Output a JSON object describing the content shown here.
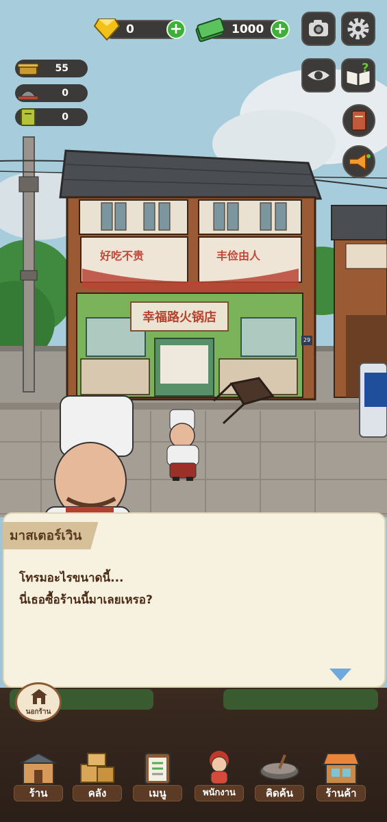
{
  "currency": {
    "gems": "0",
    "cash": "1000"
  },
  "stats": [
    {
      "icon": "hotpot-icon",
      "value": "55"
    },
    {
      "icon": "dish-cloche-icon",
      "value": "0"
    },
    {
      "icon": "recipe-book-icon",
      "value": "0"
    }
  ],
  "shop": {
    "signboard": "幸福路火锅店",
    "left_slogan": "好吃不贵",
    "right_slogan": "丰俭由人",
    "door_number": "29"
  },
  "dialog": {
    "speaker": "มาสเตอร์เวิน",
    "line1": "โทรมอะไรขนาดนี้...",
    "line2": "นี่เธอซื้อร้านนี้มาเลยเหรอ?"
  },
  "outside_button": {
    "label": "นอกร้าน"
  },
  "nav": [
    {
      "label": "ร้าน",
      "icon": "shop-building-icon"
    },
    {
      "label": "คลัง",
      "icon": "storage-boxes-icon"
    },
    {
      "label": "เมนู",
      "icon": "menu-clipboard-icon"
    },
    {
      "label": "พนักงาน",
      "icon": "staff-girl-icon"
    },
    {
      "label": "คิดค้น",
      "icon": "research-pot-icon"
    },
    {
      "label": "ร้านค้า",
      "icon": "store-awning-icon"
    }
  ]
}
